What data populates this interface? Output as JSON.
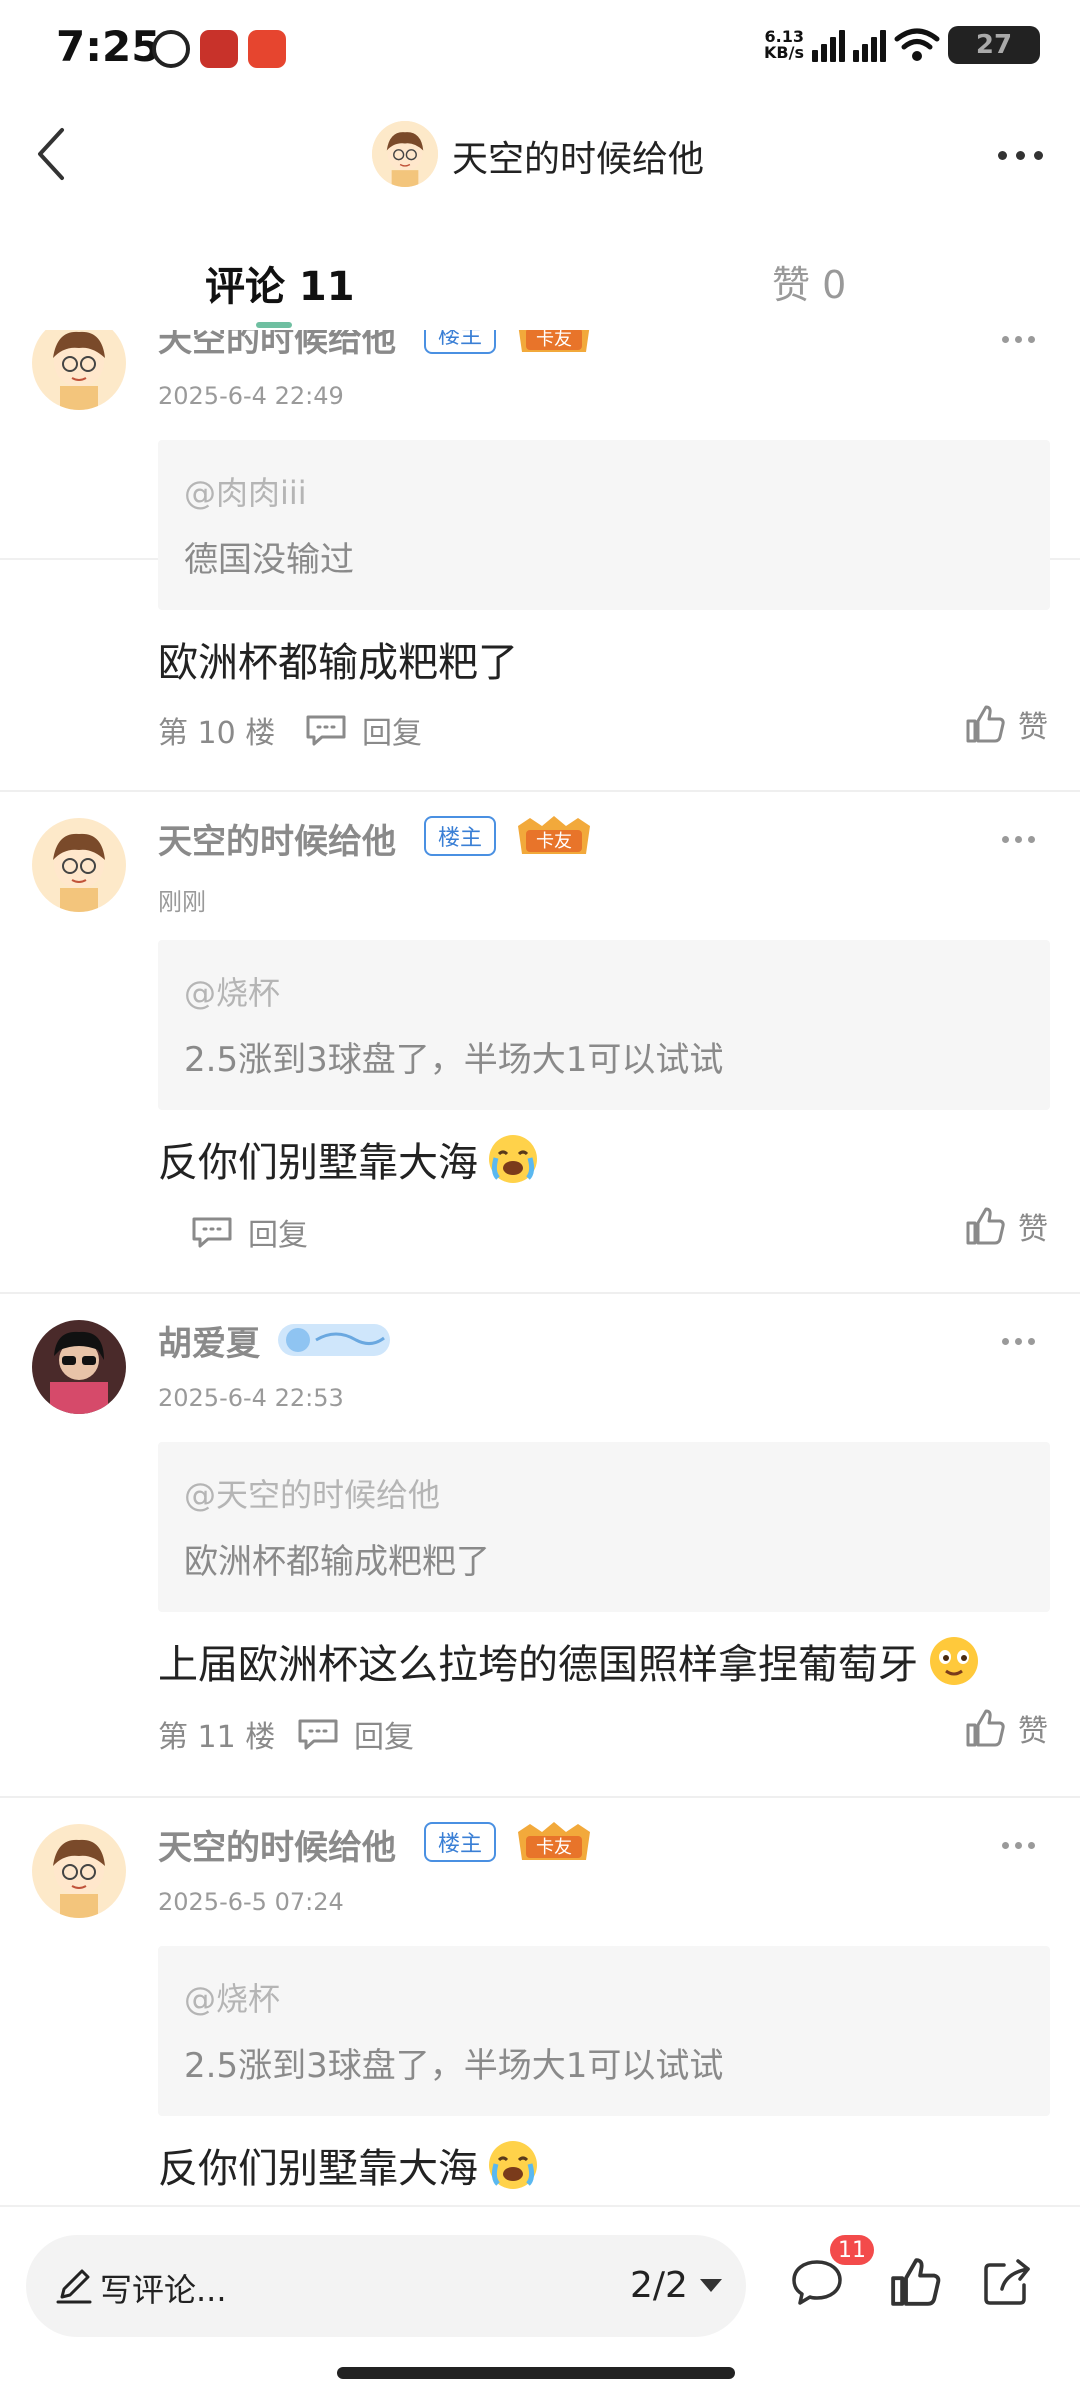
{
  "status_bar": {
    "time": "7:25",
    "net_speed": "6.13",
    "net_unit": "KB/s",
    "battery": "27"
  },
  "header": {
    "title": "天空的时候给他",
    "back_icon": "chevron-left-icon",
    "more_icon": "more-horizontal-icon"
  },
  "tabs": {
    "comments": "评论 11",
    "likes": "赞 0"
  },
  "labels": {
    "owner_badge": "楼主",
    "card_badge": "卡友",
    "reply": "回复",
    "like": "赞"
  },
  "posts": [
    {
      "user": "天空的时候给他",
      "time": "2025-6-4 22:49",
      "quote_user": "@肉肉iii",
      "quote_text": "德国没输过",
      "text": "欧洲杯都输成粑粑了",
      "floor": "第 10 楼"
    },
    {
      "user": "天空的时候给他",
      "time": "刚刚",
      "quote_user": "@烧杯",
      "quote_text": "2.5涨到3球盘了，半场大1可以试试",
      "text": "反你们别墅靠大海",
      "floor": ""
    },
    {
      "user": "胡爱夏",
      "time": "2025-6-4 22:53",
      "quote_user": "@天空的时候给他",
      "quote_text": "欧洲杯都输成粑粑了",
      "text": "上届欧洲杯这么拉垮的德国照样拿捏葡萄牙",
      "floor": "第 11 楼"
    },
    {
      "user": "天空的时候给他",
      "time": "2025-6-5 07:24",
      "quote_user": "@烧杯",
      "quote_text": "2.5涨到3球盘了，半场大1可以试试",
      "text": "反你们别墅靠大海",
      "floor": ""
    }
  ],
  "bottom_bar": {
    "input_placeholder": "写评论...",
    "pager": "2/2",
    "comment_count": "11"
  },
  "colors": {
    "accent_tab": "#6fbfa1",
    "owner_badge": "#4a90e2",
    "notification": "#f34b4b"
  }
}
